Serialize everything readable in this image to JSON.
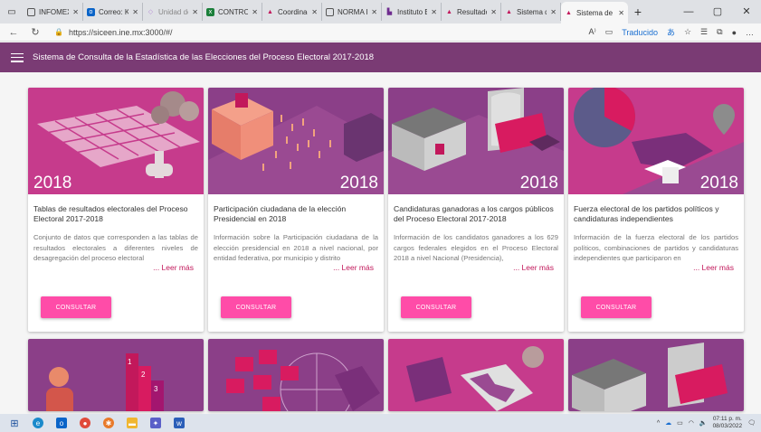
{
  "browser": {
    "tabs": [
      {
        "label": "INFOMEX",
        "color": "#555555"
      },
      {
        "label": "Correo: KA",
        "color": "#0a64c8"
      },
      {
        "label": "Unidad de",
        "color": "#b58ad6"
      },
      {
        "label": "CONTROLE",
        "color": "#1b7f3a"
      },
      {
        "label": "Coordinaci",
        "color": "#c2185b"
      },
      {
        "label": "NORMA IN",
        "color": "#555555"
      },
      {
        "label": "Instituto El",
        "color": "#6f2c8f"
      },
      {
        "label": "Resultados",
        "color": "#c2185b"
      },
      {
        "label": "Sistema de",
        "color": "#c2185b"
      },
      {
        "label": "Sistema de",
        "color": "#c2185b",
        "active": true
      }
    ],
    "url": "https://siceen.ine.mx:3000/#/",
    "translated": "Traducido"
  },
  "app": {
    "title": "Sistema de Consulta de la Estadística de las Elecciones del Proceso Electoral 2017-2018"
  },
  "cards": [
    {
      "year": "2018",
      "title": "Tablas de resultados electorales del Proceso Electoral 2017-2018",
      "desc": "Conjunto de datos que corresponden a las tablas de resultados electorales a diferentes niveles de desagregación del proceso electoral",
      "more": "... Leer más",
      "button": "CONSULTAR"
    },
    {
      "year": "2018",
      "title": "Participación ciudadana de la elección Presidencial en 2018",
      "desc": "Información sobre la Participación ciudadana de la elección presidencial en 2018 a nivel nacional, por entidad federativa, por municipio y distrito",
      "more": "... Leer más",
      "button": "CONSULTAR"
    },
    {
      "year": "2018",
      "title": "Candidaturas ganadoras a los cargos públicos del Proceso Electoral 2017-2018",
      "desc": "Información de los candidatos ganadores a los 629 cargos federales elegidos en el Proceso Electoral 2018 a nivel Nacional (Presidencia),",
      "more": "... Leer más",
      "button": "CONSULTAR"
    },
    {
      "year": "2018",
      "title": "Fuerza electoral de los partidos políticos y candidaturas independientes",
      "desc": "Información de la fuerza electoral de los partidos políticos, combinaciones de partidos y candidaturas independientes que participaron en",
      "more": "... Leer más",
      "button": "CONSULTAR"
    }
  ],
  "taskbar": {
    "time": "07:11 p. m.",
    "date": "08/03/2022"
  }
}
